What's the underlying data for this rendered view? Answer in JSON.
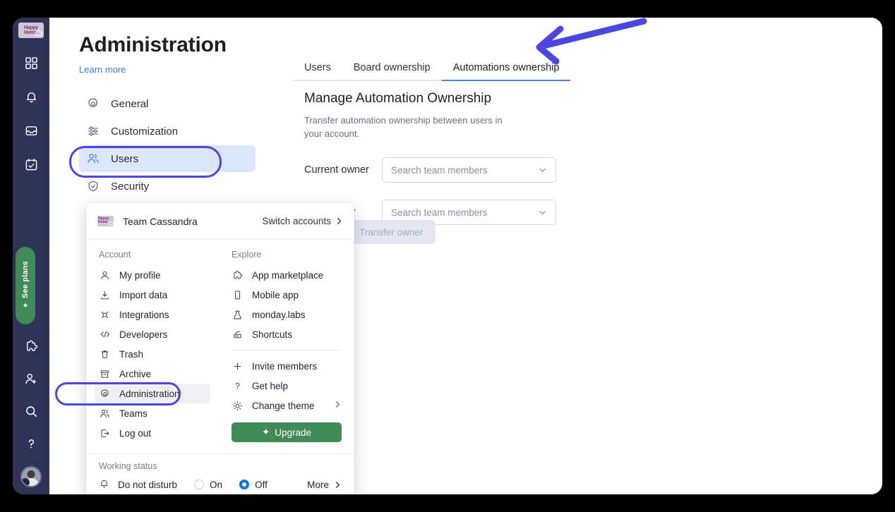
{
  "rail": {
    "logo": {
      "name": "happy-home-logo",
      "line1": "Happy",
      "line2": "Home"
    },
    "top_icons": [
      {
        "name": "home-grid-icon",
        "label": "Home"
      },
      {
        "name": "bell-icon",
        "label": "Notifications"
      },
      {
        "name": "inbox-icon",
        "label": "Inbox"
      },
      {
        "name": "my-work-icon",
        "label": "My work"
      }
    ],
    "see_plans": {
      "label": "See plans",
      "color": "#3f8a56"
    },
    "bottom_icons": [
      {
        "name": "puzzle-icon",
        "label": "Apps"
      },
      {
        "name": "invite-member-icon",
        "label": "Invite members"
      },
      {
        "name": "search-icon",
        "label": "Search"
      },
      {
        "name": "help-icon",
        "label": "Help"
      }
    ],
    "avatar": {
      "name": "user-avatar",
      "label": "Profile"
    }
  },
  "admin": {
    "title": "Administration",
    "learn_more": "Learn more",
    "nav": [
      {
        "label": "General",
        "icon": "gear-icon",
        "selected": false
      },
      {
        "label": "Customization",
        "icon": "sliders-icon",
        "selected": false
      },
      {
        "label": "Users",
        "icon": "users-icon",
        "selected": true
      },
      {
        "label": "Security",
        "icon": "shield-icon",
        "selected": false
      }
    ]
  },
  "tabs": [
    {
      "label": "Users",
      "active": false
    },
    {
      "label": "Board ownership",
      "active": false
    },
    {
      "label": "Automations ownership",
      "active": true
    }
  ],
  "panel": {
    "title": "Manage Automation Ownership",
    "description": "Transfer automation ownership between users in your account.",
    "fields": [
      {
        "label": "Current owner",
        "placeholder": "Search team members",
        "value": ""
      },
      {
        "label": "New owner",
        "placeholder": "Search team members",
        "value": ""
      }
    ],
    "transfer_button": "Transfer owner"
  },
  "dropdown": {
    "team_name": "Team Cassandra",
    "team_logo": {
      "line1": "Happy",
      "line2": "Home"
    },
    "switch_accounts": "Switch accounts",
    "account_label": "Account",
    "account_items": [
      {
        "label": "My profile",
        "icon": "person-icon",
        "hover": false
      },
      {
        "label": "Import data",
        "icon": "download-icon",
        "hover": false
      },
      {
        "label": "Integrations",
        "icon": "integrations-icon",
        "hover": false
      },
      {
        "label": "Developers",
        "icon": "code-icon",
        "hover": false
      },
      {
        "label": "Trash",
        "icon": "trash-icon",
        "hover": false
      },
      {
        "label": "Archive",
        "icon": "archive-icon",
        "hover": false
      },
      {
        "label": "Administration",
        "icon": "gear-icon",
        "hover": true
      },
      {
        "label": "Teams",
        "icon": "teams-icon",
        "hover": false
      },
      {
        "label": "Log out",
        "icon": "logout-icon",
        "hover": false
      }
    ],
    "explore_label": "Explore",
    "explore_items": [
      {
        "label": "App marketplace",
        "icon": "puzzle-icon"
      },
      {
        "label": "Mobile app",
        "icon": "mobile-icon"
      },
      {
        "label": "monday.labs",
        "icon": "flask-icon"
      },
      {
        "label": "Shortcuts",
        "icon": "shortcuts-icon"
      }
    ],
    "extra_items": [
      {
        "label": "Invite members",
        "icon": "plus-icon",
        "chevron": false
      },
      {
        "label": "Get help",
        "icon": "question-icon",
        "chevron": false
      },
      {
        "label": "Change theme",
        "icon": "sun-icon",
        "chevron": true
      }
    ],
    "upgrade_button": "Upgrade",
    "working_status": {
      "label": "Working status",
      "dnd_label": "Do not disturb",
      "on_label": "On",
      "off_label": "Off",
      "selected": "Off",
      "more_label": "More"
    }
  },
  "annotations": {
    "accent_color": "#4b46e0",
    "arrow": {
      "name": "pointer-arrow",
      "points_to": "Automations ownership"
    },
    "boxes": [
      {
        "name": "highlight-users-nav",
        "target": "Users"
      },
      {
        "name": "highlight-administration-menu",
        "target": "Administration"
      }
    ]
  }
}
